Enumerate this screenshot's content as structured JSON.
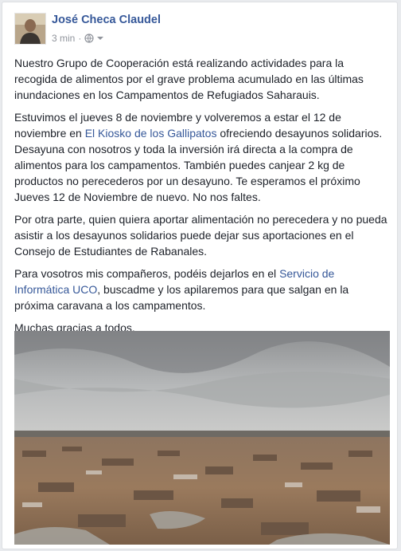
{
  "post": {
    "author": "José Checa Claudel",
    "timestamp": "3 min",
    "privacy_icon": "globe-icon",
    "options_icon": "chevron-down-icon",
    "paragraphs": {
      "p1": "Nuestro Grupo de Cooperación está realizando actividades para la recogida de alimentos por el grave problema acumulado en las últimas inundaciones en los Campamentos de Refugiados Saharauis.",
      "p2_before": "Estuvimos el jueves 8 de noviembre y volveremos a estar el 12 de noviembre en ",
      "p2_link": "El Kiosko de los Gallipatos",
      "p2_after": " ofreciendo desayunos solidarios. Desayuna con nosotros y toda la inversión irá directa a la compra de alimentos para los campamentos. También puedes canjear 2 kg de productos no perecederos por un desayuno. Te esperamos el próximo Jueves 12 de Noviembre de nuevo. No nos faltes.",
      "p3": "Por otra parte, quien quiera aportar alimentación no perecedera y no pueda asistir a los desayunos solidarios puede dejar sus aportaciones en el Consejo de Estudiantes de Rabanales.",
      "p4_before": "Para vosotros mis compañeros, podéis dejarlos en el ",
      "p4_link": "Servicio de Informática UCO",
      "p4_after": ", buscadme y los apilaremos para que salgan en la próxima caravana a los campamentos.",
      "p5": "Muchas gracias a todos."
    }
  },
  "colors": {
    "link": "#365899",
    "text": "#1d2129",
    "meta": "#90949c"
  }
}
